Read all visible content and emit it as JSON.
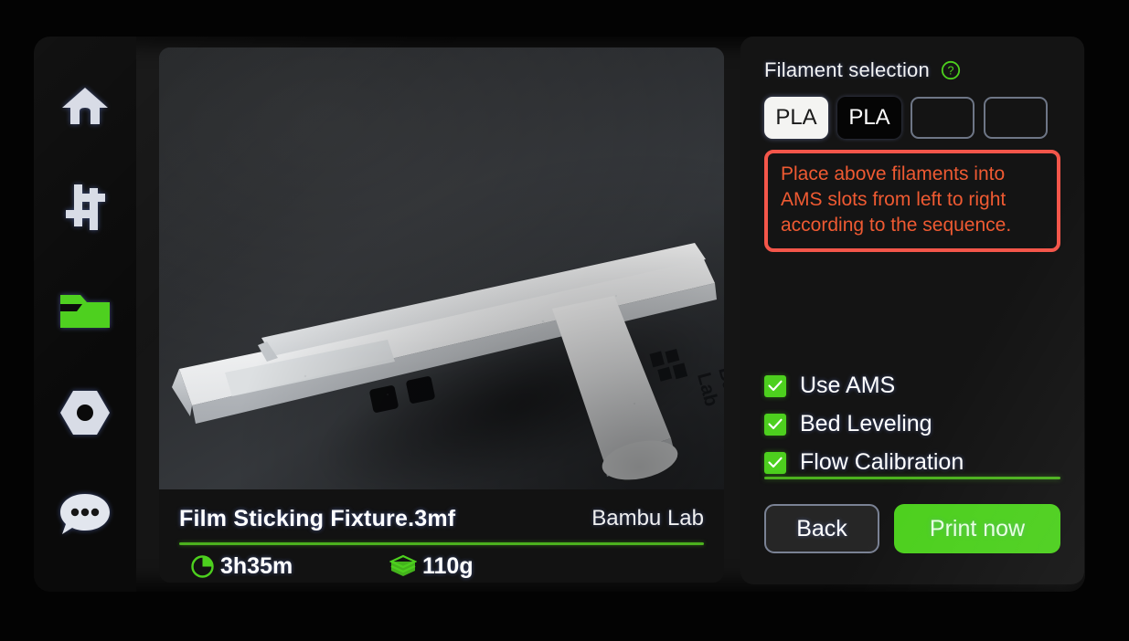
{
  "sidebar": {
    "items": [
      {
        "name": "home",
        "icon": "home-icon",
        "active": false
      },
      {
        "name": "control",
        "icon": "sliders-icon",
        "active": false
      },
      {
        "name": "files",
        "icon": "folder-icon",
        "active": true
      },
      {
        "name": "calibration",
        "icon": "hex-nut-icon",
        "active": false
      },
      {
        "name": "messages",
        "icon": "chat-bubble-icon",
        "active": false
      }
    ]
  },
  "preview": {
    "photo_alt": "white 3D printed T-shaped film sticking fixture on dark mat",
    "logo_text_line1": "Bambu",
    "logo_text_line2": "Lab",
    "file_name": "Film Sticking Fixture.3mf",
    "brand": "Bambu Lab",
    "print_time": "3h35m",
    "filament_weight": "110g",
    "time_icon": "clock-icon",
    "weight_icon": "filament-stack-icon"
  },
  "settings": {
    "title": "Filament selection",
    "help_icon": "help-circle-icon",
    "slots": [
      {
        "label": "PLA",
        "state": "filled-light"
      },
      {
        "label": "PLA",
        "state": "filled-dark"
      },
      {
        "label": "",
        "state": "empty"
      },
      {
        "label": "",
        "state": "empty"
      }
    ],
    "warning": "Place above filaments into AMS slots from left to right according to the sequence.",
    "options": [
      {
        "label": "Use AMS",
        "checked": true
      },
      {
        "label": "Bed Leveling",
        "checked": true
      },
      {
        "label": "Flow Calibration",
        "checked": true
      }
    ],
    "back_label": "Back",
    "print_label": "Print now"
  },
  "colors": {
    "accent_green": "#4dd01e",
    "divider_green": "#4cb11e",
    "warning_border": "#f4564a",
    "warning_text": "#ef5a32",
    "panel_bg": "#141414",
    "card_bg": "#121212",
    "rail_bg": "#0a0a0a",
    "text_primary": "#ffffff",
    "slot_outline": "#6e7686"
  }
}
